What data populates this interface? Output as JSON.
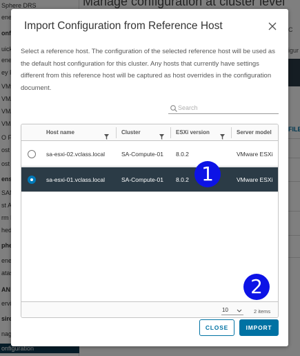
{
  "background": {
    "title": "Manage configuration at cluster level",
    "sidebar_items": [
      {
        "label": "Sphere DRS",
        "bold": false,
        "active": false
      },
      {
        "label": "eneral",
        "bold": false,
        "active": false
      },
      {
        "label": "onfiguratio",
        "bold": true,
        "active": false
      },
      {
        "label": "uickstart",
        "bold": false,
        "active": false
      },
      {
        "label": "eneral",
        "bold": false,
        "active": false
      },
      {
        "label": "ey Provide",
        "bold": false,
        "active": false
      },
      {
        "label": "VMware EV",
        "bold": false,
        "active": false
      },
      {
        "label": "VM/Host G",
        "bold": false,
        "active": false
      },
      {
        "label": "VM/Host Ru",
        "bold": false,
        "active": false
      },
      {
        "label": "VM Overrid",
        "bold": false,
        "active": false
      },
      {
        "label": "O Filters",
        "bold": false,
        "active": false
      },
      {
        "label": "ost Option",
        "bold": false,
        "active": false
      },
      {
        "label": "ost Profile",
        "bold": false,
        "active": false
      },
      {
        "label": "ensing",
        "bold": true,
        "active": false
      },
      {
        "label": "SAN Cluster",
        "bold": false,
        "active": false
      },
      {
        "label": "st Auth",
        "bold": false,
        "active": false
      },
      {
        "label": "rm Definit",
        "bold": false,
        "active": false
      },
      {
        "label": "heduled Ta",
        "bold": false,
        "active": false
      },
      {
        "label": "phere Clus",
        "bold": true,
        "active": false
      },
      {
        "label": "eneral",
        "bold": false,
        "active": false
      },
      {
        "label": "atastore S",
        "bold": false,
        "active": false
      },
      {
        "label": "AN",
        "bold": true,
        "active": false
      },
      {
        "label": "ervices",
        "bold": false,
        "active": false
      },
      {
        "label": "sired Sta",
        "bold": true,
        "active": false
      },
      {
        "label": "nage",
        "bold": false,
        "active": false
      },
      {
        "label": "onfiguration",
        "bold": false,
        "active": true
      }
    ],
    "edge_texts": [
      {
        "label": "C",
        "blue": false
      },
      {
        "label": "igur",
        "blue": false
      },
      {
        "label": "FILE",
        "blue": true
      }
    ]
  },
  "modal": {
    "title": "Import Configuration from Reference Host",
    "description": "Select a reference host. The configuration of the selected reference host will be used as the default host configuration for this cluster. Any hosts that currently have settings different from this reference host will be captured as host overrides in the configuration document.",
    "search": {
      "placeholder": "Search",
      "value": ""
    },
    "columns": [
      "Host name",
      "Cluster",
      "ESXi version",
      "Server model"
    ],
    "rows": [
      {
        "host": "sa-esxi-02.vclass.local",
        "cluster": "SA-Compute-01",
        "version": "8.0.2",
        "model": "VMware ESXi",
        "selected": false
      },
      {
        "host": "sa-esxi-01.vclass.local",
        "cluster": "SA-Compute-01",
        "version": "8.0.2",
        "model": "VMware ESXi",
        "selected": true
      }
    ],
    "footer": {
      "page_size": "10",
      "item_count": "2 items"
    },
    "buttons": {
      "close": "CLOSE",
      "import": "IMPORT"
    }
  },
  "markers": [
    "1",
    "2"
  ],
  "colors": {
    "accent": "#0072a3",
    "selected_row": "#2b3b46",
    "marker": "#0d13e6"
  }
}
